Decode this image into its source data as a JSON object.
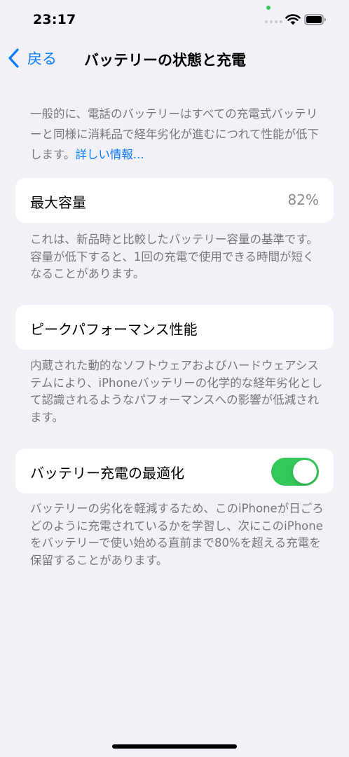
{
  "status_bar": {
    "time": "23:17"
  },
  "nav": {
    "back_label": "戻る",
    "title": "バッテリーの状態と充電"
  },
  "intro": {
    "text": "一般的に、電話のバッテリーはすべての充電式バッテリーと同様に消耗品で経年劣化が進むにつれて性能が低下します。",
    "link": "詳しい情報..."
  },
  "max_capacity": {
    "label": "最大容量",
    "value": "82%",
    "footer": "これは、新品時と比較したバッテリー容量の基準です。容量が低下すると、1回の充電で使用できる時間が短くなることがあります。"
  },
  "peak_performance": {
    "label": "ピークパフォーマンス性能",
    "footer": "内蔵された動的なソフトウェアおよびハードウェアシステムにより、iPhoneバッテリーの化学的な経年劣化として認識されるようなパフォーマンスへの影響が低減されます。"
  },
  "optimized_charging": {
    "label": "バッテリー充電の最適化",
    "enabled": true,
    "footer": "バッテリーの劣化を軽減するため、このiPhoneが日ごろどのように充電されているかを学習し、次にこのiPhoneをバッテリーで使い始める直前まで80%を超える充電を保留することがあります。"
  },
  "colors": {
    "accent": "#0a7aff",
    "toggle_on": "#34c759",
    "background": "#f2f1f7"
  }
}
